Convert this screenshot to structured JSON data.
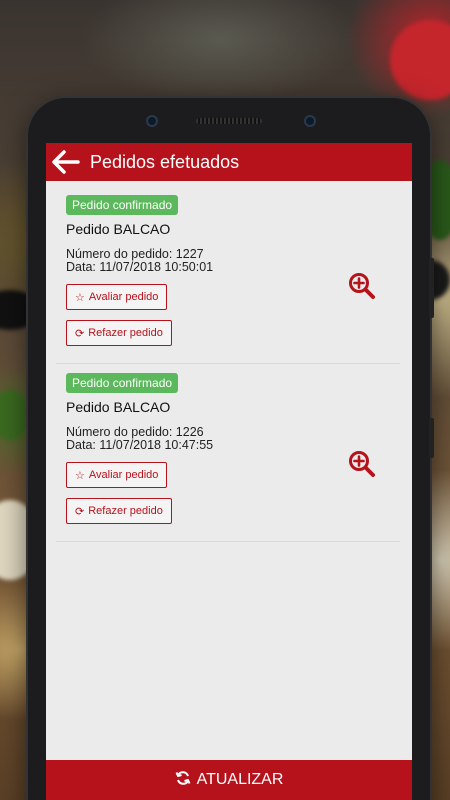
{
  "header": {
    "title": "Pedidos efetuados"
  },
  "orders": [
    {
      "status": "Pedido confirmado",
      "type": "Pedido BALCAO",
      "number_line": "Número do pedido: 1227",
      "date_line": "Data: 11/07/2018 10:50:01",
      "rate_label": "Avaliar pedido",
      "redo_label": "Refazer pedido"
    },
    {
      "status": "Pedido confirmado",
      "type": "Pedido BALCAO",
      "number_line": "Número do pedido: 1226",
      "date_line": "Data: 11/07/2018 10:47:55",
      "rate_label": "Avaliar pedido",
      "redo_label": "Refazer pedido"
    }
  ],
  "footer": {
    "refresh_label": "ATUALIZAR"
  },
  "colors": {
    "brand": "#b5121b",
    "status_ok": "#5cb85c",
    "screen_bg": "#ebebeb"
  },
  "icons": {
    "back": "arrow-left-icon",
    "star": "star-outline-icon",
    "refresh": "refresh-icon",
    "zoom": "zoom-in-icon"
  }
}
